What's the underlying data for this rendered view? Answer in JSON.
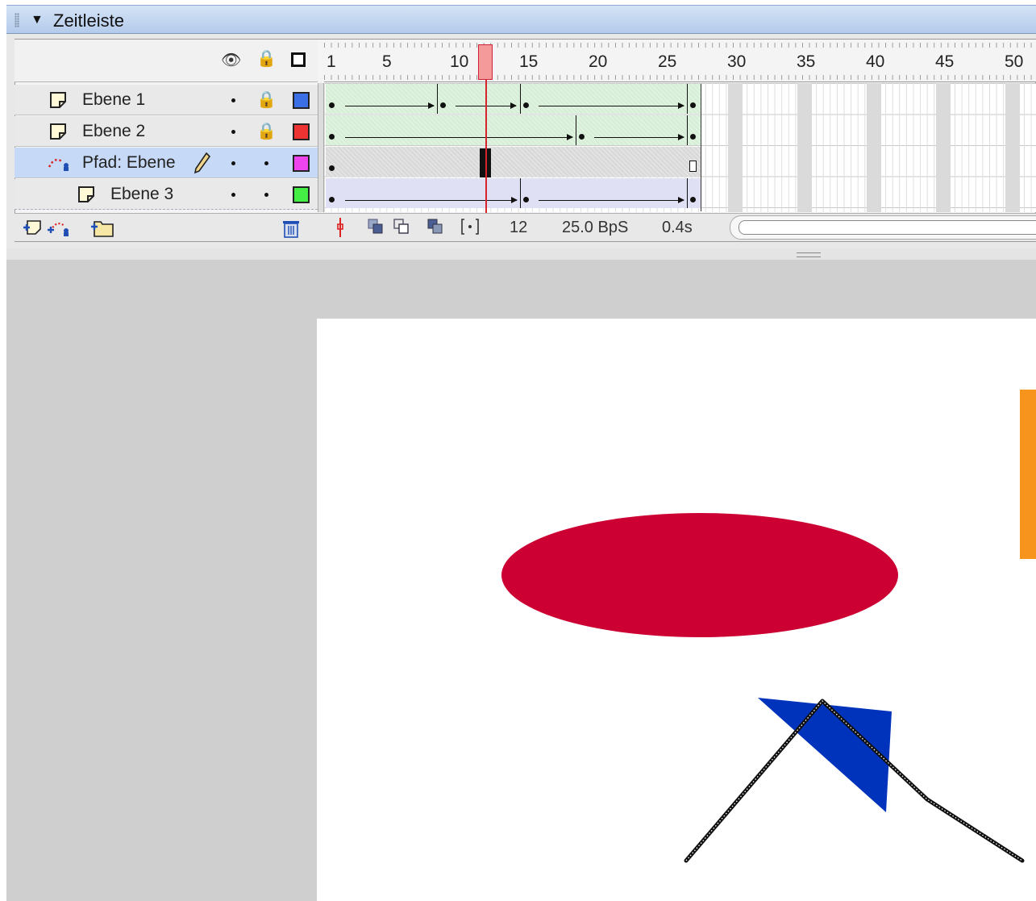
{
  "panel": {
    "title": "Zeitleiste"
  },
  "ruler": {
    "labels": [
      "1",
      "5",
      "10",
      "15",
      "20",
      "25",
      "30",
      "35",
      "40",
      "45",
      "50"
    ],
    "current_frame": 12
  },
  "layers": [
    {
      "name": "Ebene 1",
      "type": "normal",
      "visible": true,
      "locked": true,
      "color": "#3b6fe6"
    },
    {
      "name": "Ebene 2",
      "type": "normal",
      "visible": true,
      "locked": true,
      "color": "#ee3333"
    },
    {
      "name": "Pfad: Ebene",
      "type": "motion-guide",
      "visible": true,
      "locked": false,
      "color": "#ee44ee",
      "selected": true
    },
    {
      "name": "Ebene 3",
      "type": "guided",
      "visible": true,
      "locked": false,
      "color": "#44ee44"
    }
  ],
  "status": {
    "frame": "12",
    "fps": "25.0 BpS",
    "time": "0.4s"
  },
  "stage": {
    "ellipse_color": "#cc0033",
    "triangle_color": "#0033bb",
    "orange_bar_color": "#f7941d"
  }
}
